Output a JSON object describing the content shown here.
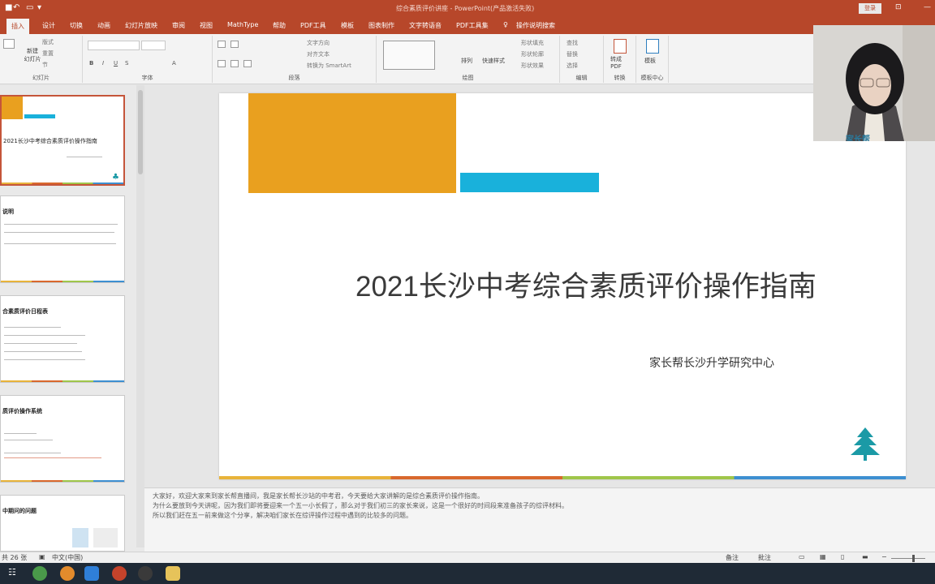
{
  "window": {
    "title": "综合素质评价讲座 - PowerPoint(产品激活失败)",
    "login_label": "登录"
  },
  "tabs": [
    {
      "label": "插入"
    },
    {
      "label": "设计"
    },
    {
      "label": "切换"
    },
    {
      "label": "动画"
    },
    {
      "label": "幻灯片放映"
    },
    {
      "label": "审阅"
    },
    {
      "label": "视图"
    },
    {
      "label": "MathType"
    },
    {
      "label": "帮助"
    },
    {
      "label": "PDF工具"
    },
    {
      "label": "模板"
    },
    {
      "label": "图表制作"
    },
    {
      "label": "文字转语音"
    },
    {
      "label": "PDF工具集"
    },
    {
      "label": "操作说明搜索"
    }
  ],
  "ribbon": {
    "slides_group": {
      "new_slide": "新建\n幻灯片",
      "layout": "版式",
      "reset": "重置",
      "section": "节",
      "label": "幻灯片"
    },
    "font_group": {
      "label": "字体"
    },
    "paragraph_group": {
      "text_direction": "文字方向",
      "align_text": "对齐文本",
      "smartart": "转换为 SmartArt",
      "label": "段落"
    },
    "drawing_group": {
      "arrange": "排列",
      "quick_styles": "快速样式",
      "shape_fill": "形状填充",
      "shape_outline": "形状轮廓",
      "shape_effects": "形状效果",
      "label": "绘图"
    },
    "editing_group": {
      "find": "查找",
      "replace": "替换",
      "select": "选择",
      "label": "编辑"
    },
    "convert_group": {
      "to_pdf": "转成\nPDF",
      "label": "转换"
    },
    "template_group": {
      "template": "模板",
      "label": "模板中心"
    }
  },
  "thumbnails": [
    {
      "title": "2021长沙中考综合素质评价操作指南"
    },
    {
      "title": "说明"
    },
    {
      "title": "合素质评价日程表"
    },
    {
      "title": "质评价操作系统"
    },
    {
      "title": "中期问的问题"
    }
  ],
  "slide": {
    "title": "2021长沙中考综合素质评价操作指南",
    "subtitle": "家长帮长沙升学研究中心"
  },
  "webcam": {
    "overlay_text": "家长帮"
  },
  "notes": {
    "lines": [
      "大家好，欢迎大家来到家长帮直播间，我是家长帮长沙站的中考君，今天要给大家讲解的是综合素质评价操作指南。",
      "为什么要放到今天讲呢，因为我们即将要迎来一个五一小长假了，那么对于我们初三的家长来说，这是一个很好的时间段来准备孩子的综评材料。",
      "所以我们赶在五一前来做这个分享，解决咱们家长在综评操作过程中遇到的比较多的问题。"
    ]
  },
  "status": {
    "slide_count": "共 26 张",
    "language": "中文(中国)",
    "notes": "备注",
    "comments": "批注"
  },
  "colors": {
    "accent": "#b7472a",
    "orange": "#e9a01f",
    "cyan": "#19b1db",
    "logo_teal": "#1b9aa6"
  }
}
